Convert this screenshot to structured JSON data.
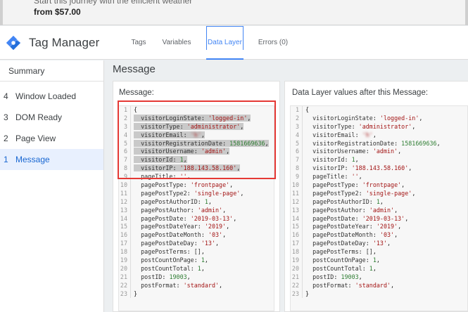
{
  "site": {
    "line1": "Start this journey with the efficient weather",
    "price": "from $57.00"
  },
  "header": {
    "brand": "Tag Manager",
    "logo_icon": "tag-manager-diamond-icon",
    "tabs": [
      {
        "label": "Tags",
        "active": false
      },
      {
        "label": "Variables",
        "active": false
      },
      {
        "label": "Data Layer",
        "active": true
      },
      {
        "label": "Errors (0)",
        "active": false
      }
    ]
  },
  "sidebar": {
    "summary": "Summary",
    "items": [
      {
        "num": "4",
        "label": "Window Loaded",
        "selected": false
      },
      {
        "num": "3",
        "label": "DOM Ready",
        "selected": false
      },
      {
        "num": "2",
        "label": "Page View",
        "selected": false
      },
      {
        "num": "1",
        "label": "Message",
        "selected": true
      }
    ]
  },
  "main": {
    "title": "Message",
    "left_panel_title": "Message:",
    "right_panel_title": "Data Layer values after this Message:"
  },
  "code": {
    "line_numbers": [
      "1",
      "2",
      "3",
      "4",
      "5",
      "6",
      "7",
      "8",
      "9",
      "10",
      "11",
      "12",
      "13",
      "14",
      "15",
      "16",
      "17",
      "18",
      "19",
      "20",
      "21",
      "22",
      "23"
    ],
    "entries": [
      {
        "key": "visitorLoginState",
        "value": "'logged-in'",
        "kind": "str"
      },
      {
        "key": "visitorType",
        "value": "'administrator'",
        "kind": "str"
      },
      {
        "key": "visitorEmail",
        "value": "'h'",
        "kind": "blur"
      },
      {
        "key": "visitorRegistrationDate",
        "value": "1581669636",
        "kind": "num"
      },
      {
        "key": "visitorUsername",
        "value": "'admin'",
        "kind": "str"
      },
      {
        "key": "visitorId",
        "value": "1",
        "kind": "num"
      },
      {
        "key": "visitorIP",
        "value": "'188.143.58.160'",
        "kind": "str"
      },
      {
        "key": "pageTitle",
        "value": "''",
        "kind": "str"
      },
      {
        "key": "pagePostType",
        "value": "'frontpage'",
        "kind": "str"
      },
      {
        "key": "pagePostType2",
        "value": "'single-page'",
        "kind": "str"
      },
      {
        "key": "pagePostAuthorID",
        "value": "1",
        "kind": "num"
      },
      {
        "key": "pagePostAuthor",
        "value": "'admin'",
        "kind": "str"
      },
      {
        "key": "pagePostDate",
        "value": "'2019-03-13'",
        "kind": "str"
      },
      {
        "key": "pagePostDateYear",
        "value": "'2019'",
        "kind": "str"
      },
      {
        "key": "pagePostDateMonth",
        "value": "'03'",
        "kind": "str"
      },
      {
        "key": "pagePostDateDay",
        "value": "'13'",
        "kind": "str"
      },
      {
        "key": "pagePostTerms",
        "value": "[]",
        "kind": "plain"
      },
      {
        "key": "postCountOnPage",
        "value": "1",
        "kind": "num"
      },
      {
        "key": "postCountTotal",
        "value": "1",
        "kind": "num"
      },
      {
        "key": "postID",
        "value": "19003",
        "kind": "num"
      },
      {
        "key": "postFormat",
        "value": "'standard'",
        "kind": "str"
      }
    ],
    "open_brace": "{",
    "close_brace": "}"
  }
}
